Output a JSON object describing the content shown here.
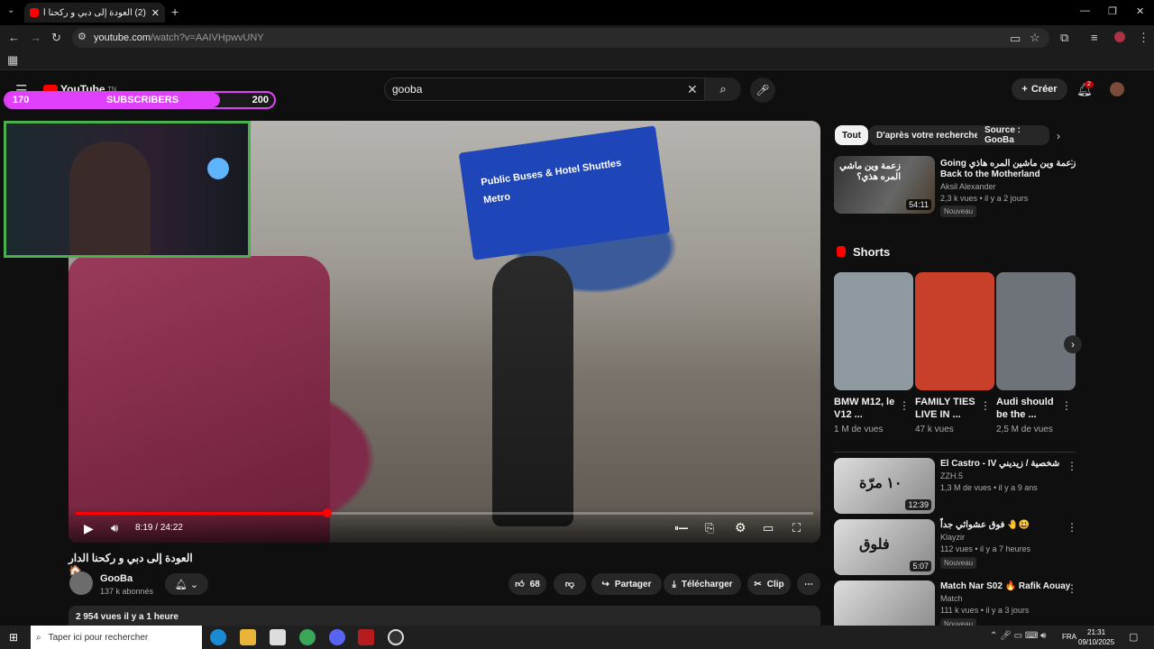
{
  "browser": {
    "tab_title": "(2) العودة إلى دبي و ركحنا الدار",
    "new_tab": "+",
    "url_host": "youtube.com",
    "url_path": "/watch?v=AAIVHpwvUNY"
  },
  "header": {
    "logo": "YouTube",
    "logo_region": "TN",
    "search_value": "gooba",
    "create_label": "Créer",
    "notif_count": "2"
  },
  "overlay": {
    "sub_start": "170",
    "sub_label": "SUBSCRIBERS",
    "sub_goal": "200",
    "sub_progress": 0.8
  },
  "player": {
    "sign_line1": "Public Buses & Hotel Shuttles",
    "sign_line2": "Metro",
    "time_current": "8:19",
    "time_total": "24:22",
    "progress": 0.341
  },
  "video": {
    "title": "العودة إلى دبي و ركحنا الدار 🏠",
    "channel": "GooBa",
    "subscribers": "137 k abonnés",
    "likes": "68",
    "share": "Partager",
    "download": "Télécharger",
    "clip": "Clip",
    "desc_line": "2 954 vues  il y a 1 heure"
  },
  "sidebar": {
    "chips": [
      "Tout",
      "D'après votre recherche",
      "Source : GooBa"
    ],
    "top_video": {
      "title_1": "Going زعمة وين ماشين المره هاذي",
      "title_2": "Back to the Motherland",
      "channel": "Aksil Alexander",
      "meta": "2,3 k vues • il y a 2 jours",
      "badge": "Nouveau",
      "duration": "54:11",
      "thumb_text": "زعمة وين ماشي المره هذي؟"
    },
    "shorts_title": "Shorts",
    "shorts": [
      {
        "title_1": "BMW M12, le",
        "title_2": "V12 ...",
        "views": "1 M de vues",
        "color": "#8f9aa0"
      },
      {
        "title_1": "FAMILY TIES",
        "title_2": "LIVE IN ...",
        "views": "47 k vues",
        "color": "#c8402a"
      },
      {
        "title_1": "Audi should",
        "title_2": "be the ...",
        "views": "2,5 M de vues",
        "color": "#6d7378"
      }
    ],
    "list": [
      {
        "title": "El Castro - IV شخصية / زيديني",
        "channel": "ZZH.5",
        "meta": "1,3 M de vues • il y a 9 ans",
        "duration": "12:39",
        "badge": "",
        "thumb_text": "١٠ مرّة"
      },
      {
        "title": "فوق عشوائي جداً 🤚😃",
        "channel": "Klayzir",
        "meta": "112 vues • il y a 7 heures",
        "duration": "5:07",
        "badge": "Nouveau",
        "thumb_text": "فلوق"
      },
      {
        "title": "Match Nar S02 🔥 Rafik Aouay",
        "channel": "Match",
        "meta": "111 k vues • il y a 3 jours",
        "duration": "",
        "badge": "Nouveau",
        "thumb_text": ""
      }
    ]
  },
  "taskbar": {
    "search_placeholder": "Taper ici pour rechercher",
    "lang": "FRA",
    "time": "21:31",
    "date": "09/10/2025"
  },
  "colors": {
    "accent": "#ff0000",
    "overlay_bar": "#e040fb",
    "cam_border": "#4caf50"
  }
}
